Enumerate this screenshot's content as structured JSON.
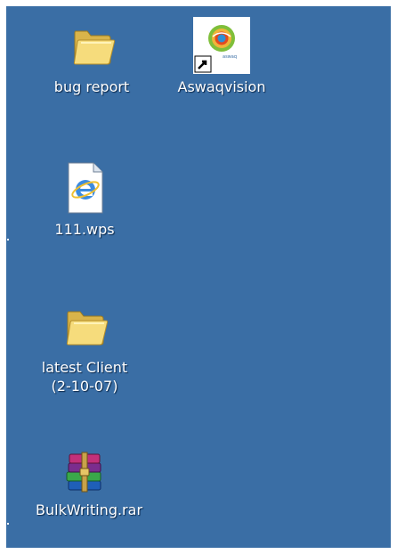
{
  "desktop": {
    "background": "#3a6ea5",
    "icons": [
      {
        "label": "bug report",
        "icon": "folder-icon"
      },
      {
        "label": "Aswaqvision",
        "icon": "aswaqvision-shortcut-icon"
      },
      {
        "label": "111.wps",
        "icon": "ie-document-icon"
      },
      {
        "label": "latest Client\n(2-10-07)",
        "icon": "folder-icon"
      },
      {
        "label": "BulkWriting.rar",
        "icon": "winrar-archive-icon"
      }
    ]
  }
}
